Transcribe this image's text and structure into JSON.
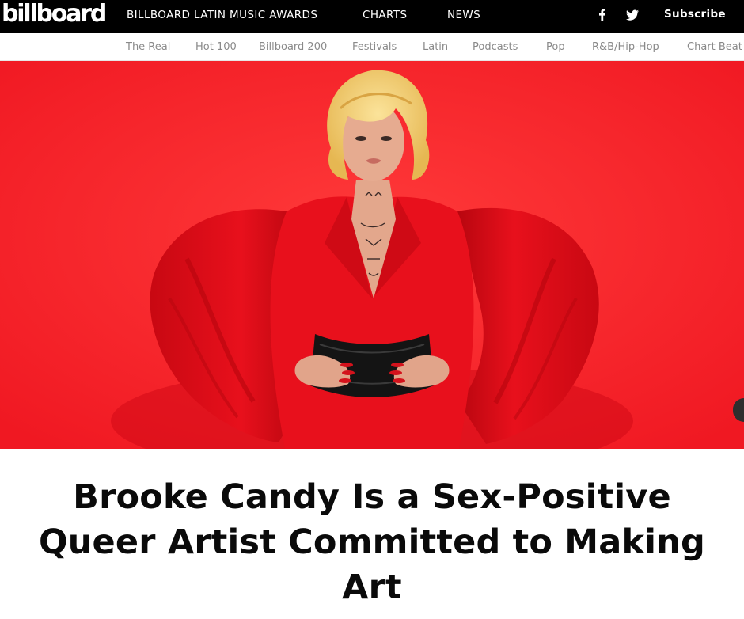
{
  "header": {
    "logo": "billboard",
    "nav": [
      "BILLBOARD LATIN MUSIC AWARDS",
      "CHARTS",
      "NEWS"
    ],
    "social_icons": [
      "facebook-icon",
      "twitter-icon"
    ],
    "subscribe_label": "Subscribe"
  },
  "subnav": {
    "items": [
      "The Real",
      "Hot 100",
      "Billboard 200",
      "Festivals",
      "Latin",
      "Podcasts",
      "Pop",
      "R&B/Hip-Hop",
      "Chart Beat"
    ]
  },
  "article": {
    "headline": "Brooke Candy Is a Sex-Positive Queer Artist Committed to Making Art"
  },
  "colors": {
    "topbar": "#000000",
    "hero_background": "#ff1f2a",
    "outfit": "#e8101c",
    "subnav_text": "#8a8a8a",
    "headline_text": "#0a0a0a"
  }
}
